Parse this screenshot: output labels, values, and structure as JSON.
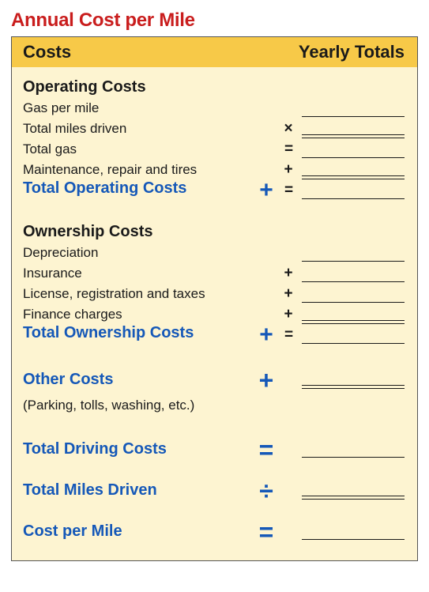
{
  "title": "Annual Cost per Mile",
  "header": {
    "left": "Costs",
    "right": "Yearly Totals"
  },
  "operating": {
    "section": "Operating Costs",
    "rows": {
      "gas_per_mile": "Gas per mile",
      "total_miles": "Total miles driven",
      "total_gas": "Total gas",
      "maintenance": "Maintenance, repair and tires"
    },
    "subtotal": "Total Operating Costs"
  },
  "ownership": {
    "section": "Ownership Costs",
    "rows": {
      "depreciation": "Depreciation",
      "insurance": "Insurance",
      "license": "License, registration and taxes",
      "finance": "Finance charges"
    },
    "subtotal": "Total Ownership Costs"
  },
  "other": {
    "label": "Other Costs",
    "sub": "(Parking, tolls, washing, etc.)"
  },
  "totals": {
    "driving": "Total Driving Costs",
    "miles": "Total Miles Driven",
    "cpm": "Cost per Mile"
  },
  "ops": {
    "times": "×",
    "plus": "+",
    "eq": "=",
    "div": "÷"
  }
}
